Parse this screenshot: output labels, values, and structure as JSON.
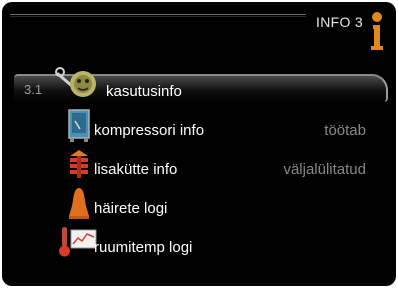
{
  "header": {
    "title": "INFO 3"
  },
  "menu": {
    "selected_number": "3.1",
    "items": [
      {
        "label": "kasutusinfo",
        "status": ""
      },
      {
        "label": "kompressori info",
        "status": "töötab"
      },
      {
        "label": "lisakütte info",
        "status": "väljalülitatud"
      },
      {
        "label": "häirete logi",
        "status": ""
      },
      {
        "label": "ruumitemp logi",
        "status": ""
      }
    ]
  },
  "icons": [
    "info-icon",
    "gears-icon",
    "compressor-icon",
    "heater-icon",
    "alarm-bell-icon",
    "thermometer-graph-icon"
  ],
  "colors": {
    "accent": "#e08a1e",
    "background": "#000000",
    "text": "#ffffff",
    "muted": "#888888"
  }
}
